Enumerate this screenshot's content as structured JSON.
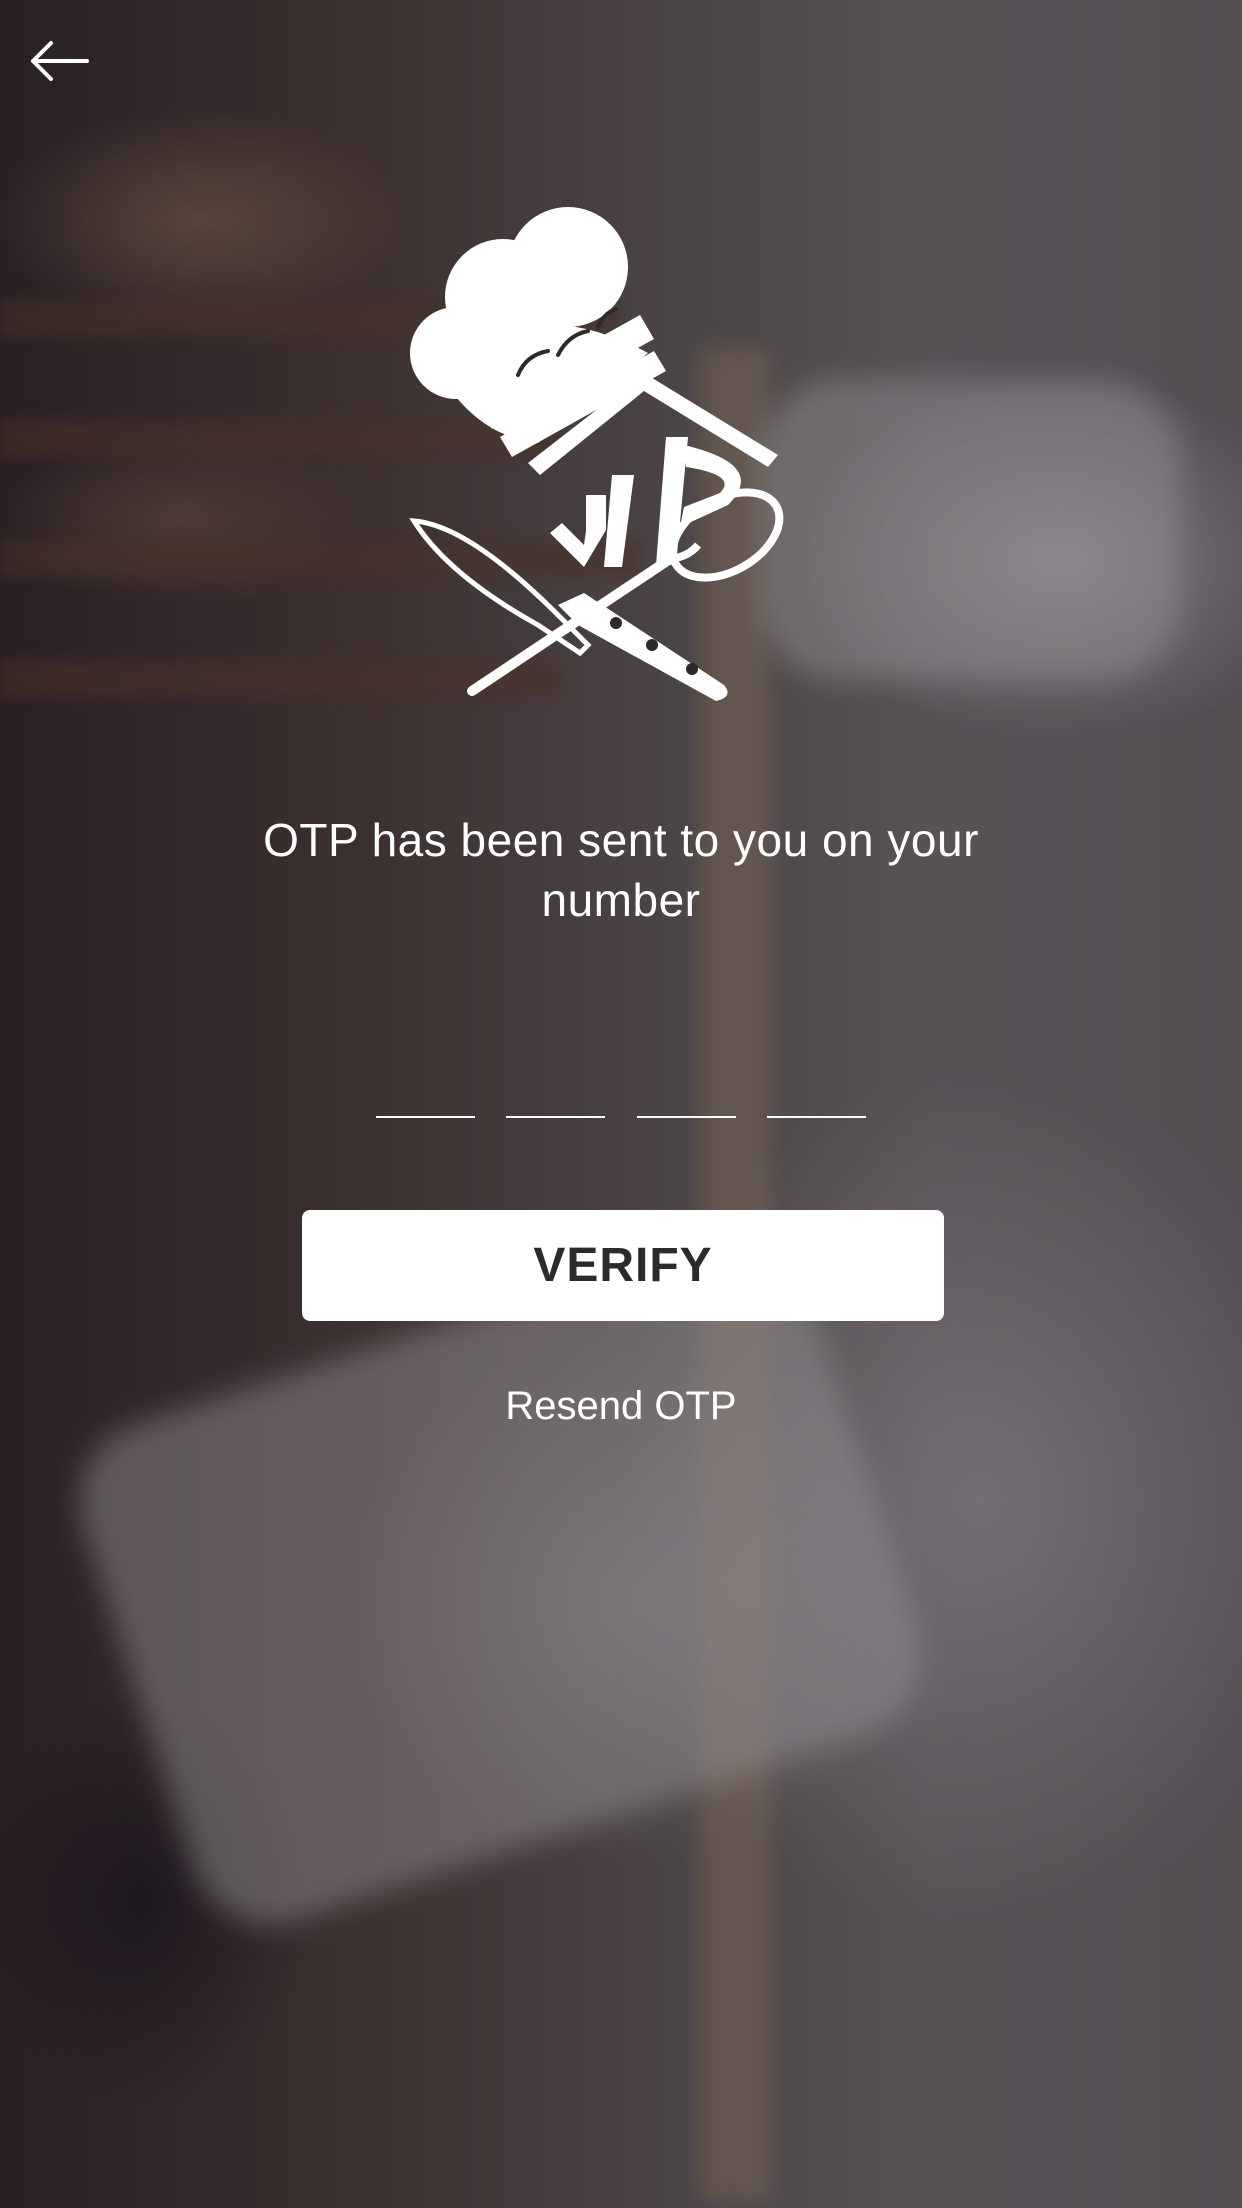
{
  "header": {
    "back_icon": "arrow-left-icon"
  },
  "logo": {
    "icon": "chef-hat-knife-spoon-logo-icon",
    "monogram": "JP"
  },
  "message": {
    "text": "OTP has been sent to you on your number"
  },
  "otp": {
    "digits": [
      "",
      "",
      "",
      ""
    ]
  },
  "actions": {
    "verify_label": "VERIFY",
    "resend_label": "Resend OTP"
  },
  "colors": {
    "text": "#ffffff",
    "button_bg": "#ffffff",
    "button_text": "#2b2b2b"
  }
}
